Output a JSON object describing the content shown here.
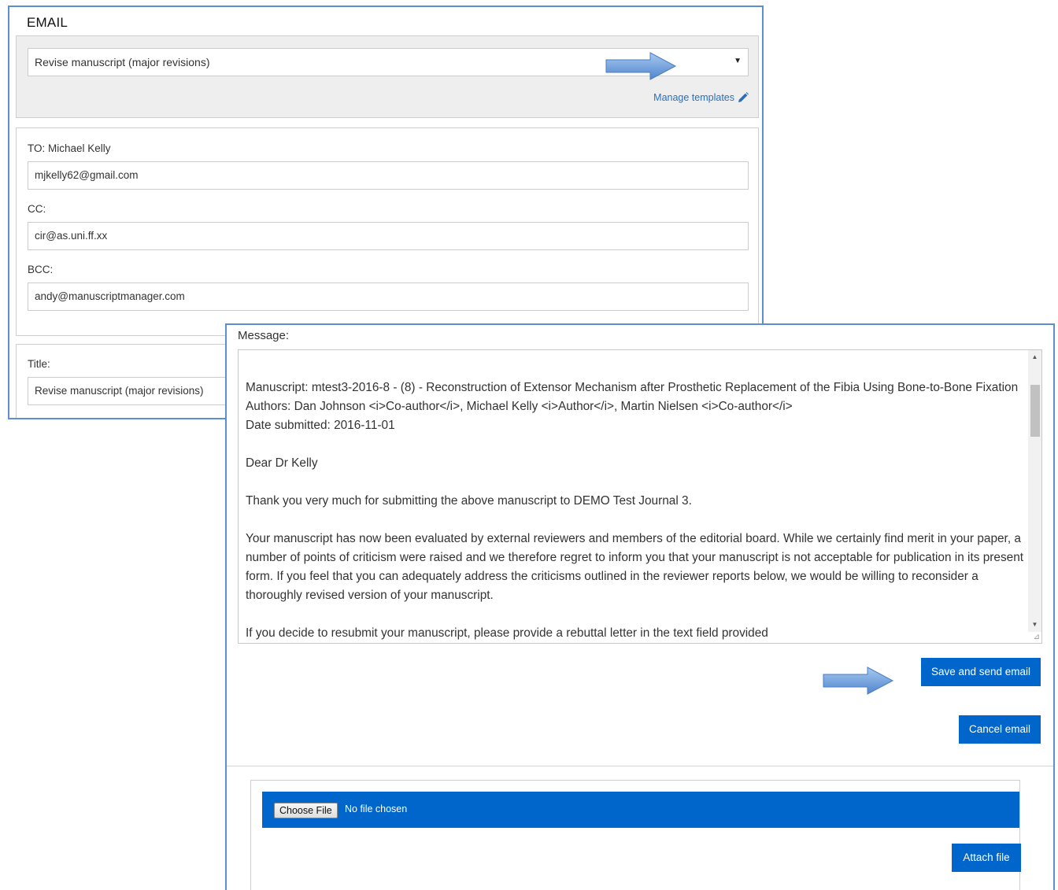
{
  "email_form": {
    "heading": "EMAIL",
    "template_select": {
      "selected": "Revise manuscript (major revisions)"
    },
    "manage_templates_label": "Manage templates",
    "to_label": "TO: Michael Kelly",
    "to_value": "mjkelly62@gmail.com",
    "cc_label": "CC:",
    "cc_value": "cir@as.uni.ff.xx",
    "bcc_label": "BCC:",
    "bcc_value": "andy@manuscriptmanager.com",
    "title_label": "Title:",
    "title_value": "Revise manuscript (major revisions)"
  },
  "message": {
    "label": "Message:",
    "manuscript_line": "Manuscript: mtest3-2016-8 - (8) - Reconstruction of Extensor Mechanism after Prosthetic Replacement of the Fibia Using Bone-to-Bone Fixation",
    "authors_line": "Authors: Dan Johnson <i>Co-author</i>, Michael Kelly <i>Author</i>, Martin Nielsen <i>Co-author</i>",
    "date_line": "Date submitted: 2016-11-01",
    "greeting": "Dear Dr Kelly",
    "thanks_paragraph": "Thank you very much for submitting the above manuscript to DEMO Test Journal 3.",
    "evaluation_paragraph": "Your manuscript has now been evaluated by external reviewers and members of the editorial board. While we certainly find merit in your paper, a number of points of criticism were raised and we therefore regret to inform you that your manuscript is not acceptable for publication in its present form. If you feel that you can adequately address the criticisms outlined in the reviewer reports below, we would be willing to reconsider a thoroughly revised version of your manuscript.",
    "cutoff_paragraph": "If you decide to resubmit your manuscript, please provide a rebuttal letter in the text field provided"
  },
  "actions": {
    "save_send_label": "Save and send email",
    "cancel_label": "Cancel email"
  },
  "attachment": {
    "choose_file_label": "Choose File",
    "no_file_text": "No file chosen",
    "attach_label": "Attach file"
  },
  "colors": {
    "primary": "#0066cc",
    "panel_border": "#5b8fcf",
    "link": "#2a6fbd"
  }
}
